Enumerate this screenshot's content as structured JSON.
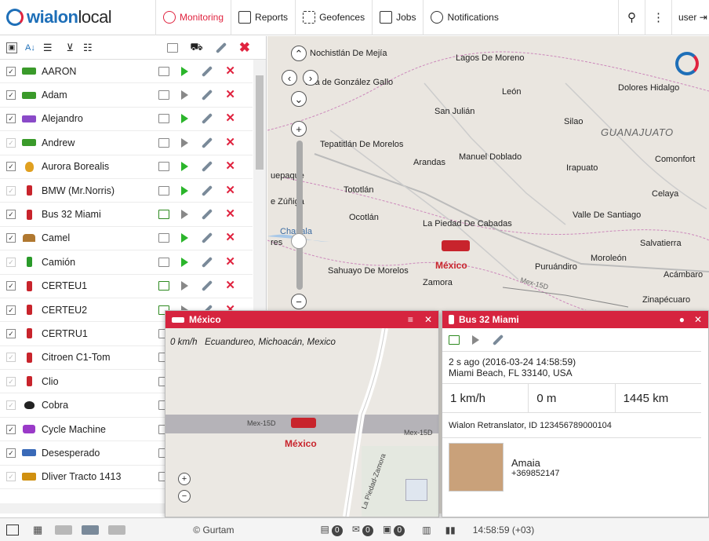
{
  "header": {
    "logo_brand": "wialon",
    "logo_suffix": "local",
    "nav": [
      {
        "label": "Monitoring",
        "icon": "globe-icon",
        "active": true
      },
      {
        "label": "Reports",
        "icon": "report-icon",
        "active": false
      },
      {
        "label": "Geofences",
        "icon": "geofence-icon",
        "active": false
      },
      {
        "label": "Jobs",
        "icon": "jobs-icon",
        "active": false
      },
      {
        "label": "Notifications",
        "icon": "bell-icon",
        "active": false
      }
    ],
    "search_icon": "⚲",
    "more_icon": "⋮",
    "user_label": "user"
  },
  "units": [
    {
      "name": "AARON",
      "checked": true,
      "icon": "car-green",
      "play": "green",
      "term": "grey"
    },
    {
      "name": "Adam",
      "checked": true,
      "icon": "car-green",
      "play": "grey",
      "term": "grey"
    },
    {
      "name": "Alejandro",
      "checked": true,
      "icon": "car-purple",
      "play": "green",
      "term": "grey"
    },
    {
      "name": "Andrew",
      "checked": false,
      "icon": "car-green",
      "play": "grey",
      "term": "grey"
    },
    {
      "name": "Aurora Borealis",
      "checked": true,
      "icon": "balloon",
      "play": "green",
      "term": "grey"
    },
    {
      "name": "BMW (Mr.Norris)",
      "checked": false,
      "icon": "phone",
      "play": "green",
      "term": "grey"
    },
    {
      "name": "Bus 32 Miami",
      "checked": true,
      "icon": "phone",
      "play": "grey",
      "term": "green"
    },
    {
      "name": "Camel",
      "checked": true,
      "icon": "camel",
      "play": "green",
      "term": "grey"
    },
    {
      "name": "Camión",
      "checked": false,
      "icon": "phone-green",
      "play": "green",
      "term": "grey"
    },
    {
      "name": "CERTEU1",
      "checked": true,
      "icon": "phone",
      "play": "grey",
      "term": "green"
    },
    {
      "name": "CERTEU2",
      "checked": true,
      "icon": "phone",
      "play": "grey",
      "term": "green"
    },
    {
      "name": "CERTRU1",
      "checked": true,
      "icon": "phone",
      "play": "grey",
      "term": "grey"
    },
    {
      "name": "Citroen C1-Tom",
      "checked": false,
      "icon": "phone",
      "play": "grey",
      "term": "grey"
    },
    {
      "name": "Clio",
      "checked": false,
      "icon": "phone",
      "play": "grey",
      "term": "grey"
    },
    {
      "name": "Cobra",
      "checked": false,
      "icon": "heart",
      "play": "grey",
      "term": "grey"
    },
    {
      "name": "Cycle Machine",
      "checked": true,
      "icon": "bike",
      "play": "grey",
      "term": "grey"
    },
    {
      "name": "Desesperado",
      "checked": true,
      "icon": "car-blue",
      "play": "grey",
      "term": "grey"
    },
    {
      "name": "Dliver Tracto 1413",
      "checked": false,
      "icon": "truck",
      "play": "grey",
      "term": "grey"
    }
  ],
  "map": {
    "labels": [
      "Nochistlán De Mejía",
      "Lagos De Moreno",
      "Villa de González Gallo",
      "León",
      "Dolores Hidalgo",
      "San Julián",
      "Silao",
      "Tepatitlán De Morelos",
      "Manuel Doblado",
      "Arandas",
      "Irapuato",
      "Comonfort",
      "uepaque",
      "Tototlán",
      "Celaya",
      "e Zúñiga",
      "Ocotlán",
      "La Piedad De Cabadas",
      "Valle De Santiago",
      "Chapala",
      "res",
      "Salvatierra",
      "Sahuayo De Morelos",
      "Puruándiro",
      "Moroleón",
      "Zamora",
      "Acámbaro",
      "Zinapécuaro",
      "Mex-15D"
    ],
    "state_label": "GUANAJUATO",
    "vehicle_label": "México"
  },
  "popup_mexico": {
    "title": "México",
    "speed": "0 km/h",
    "location": "Ecuandureo, Michoacán, Mexico",
    "road_labels": [
      "Mex-15D",
      "Mex-15D",
      "La Piedad-Zamora"
    ],
    "vehicle_label": "México"
  },
  "popup_bus": {
    "title": "Bus 32 Miami",
    "time": "2 s ago (2016-03-24 14:58:59)",
    "address": "Miami Beach, FL 33140, USA",
    "speed": "1 km/h",
    "altitude": "0 m",
    "mileage": "1445 km",
    "device": "Wialon Retranslator, ID 123456789000104",
    "driver_name": "Amaia",
    "driver_phone": "+369852147"
  },
  "footer": {
    "copyright": "© Gurtam",
    "badges": [
      "0",
      "0",
      "0"
    ],
    "time": "14:58:59 (+03)"
  },
  "colors": {
    "accent": "#e0233f",
    "brand": "#1e6fb8",
    "popup_header": "#d6243f"
  }
}
